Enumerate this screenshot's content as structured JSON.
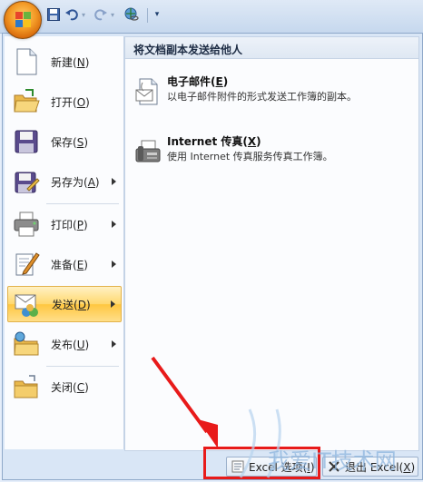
{
  "menu": {
    "items": [
      {
        "label": "新建",
        "key": "N",
        "icon": "new-document-icon",
        "submenu": false
      },
      {
        "label": "打开",
        "key": "O",
        "icon": "open-folder-icon",
        "submenu": false
      },
      {
        "label": "保存",
        "key": "S",
        "icon": "save-disk-icon",
        "submenu": false
      },
      {
        "label": "另存为",
        "key": "A",
        "icon": "save-as-icon",
        "submenu": true
      },
      {
        "label": "打印",
        "key": "P",
        "icon": "printer-icon",
        "submenu": true
      },
      {
        "label": "准备",
        "key": "E",
        "icon": "prepare-pen-icon",
        "submenu": true
      },
      {
        "label": "发送",
        "key": "D",
        "icon": "send-icon",
        "submenu": true,
        "active": true
      },
      {
        "label": "发布",
        "key": "U",
        "icon": "publish-folder-icon",
        "submenu": true
      },
      {
        "label": "关闭",
        "key": "C",
        "icon": "close-folder-icon",
        "submenu": false
      }
    ]
  },
  "send_pane": {
    "title": "将文档副本发送给他人",
    "options": [
      {
        "title": "电子邮件",
        "key": "E",
        "desc": "以电子邮件附件的形式发送工作簿的副本。",
        "icon": "email-icon"
      },
      {
        "title": "Internet 传真",
        "key": "X",
        "desc": "使用 Internet 传真服务传真工作簿。",
        "icon": "fax-icon"
      }
    ]
  },
  "bottom": {
    "options_label": "Excel 选项",
    "options_key": "I",
    "exit_label": "退出 Excel",
    "exit_key": "X"
  },
  "watermark": "我爱IT技术网"
}
